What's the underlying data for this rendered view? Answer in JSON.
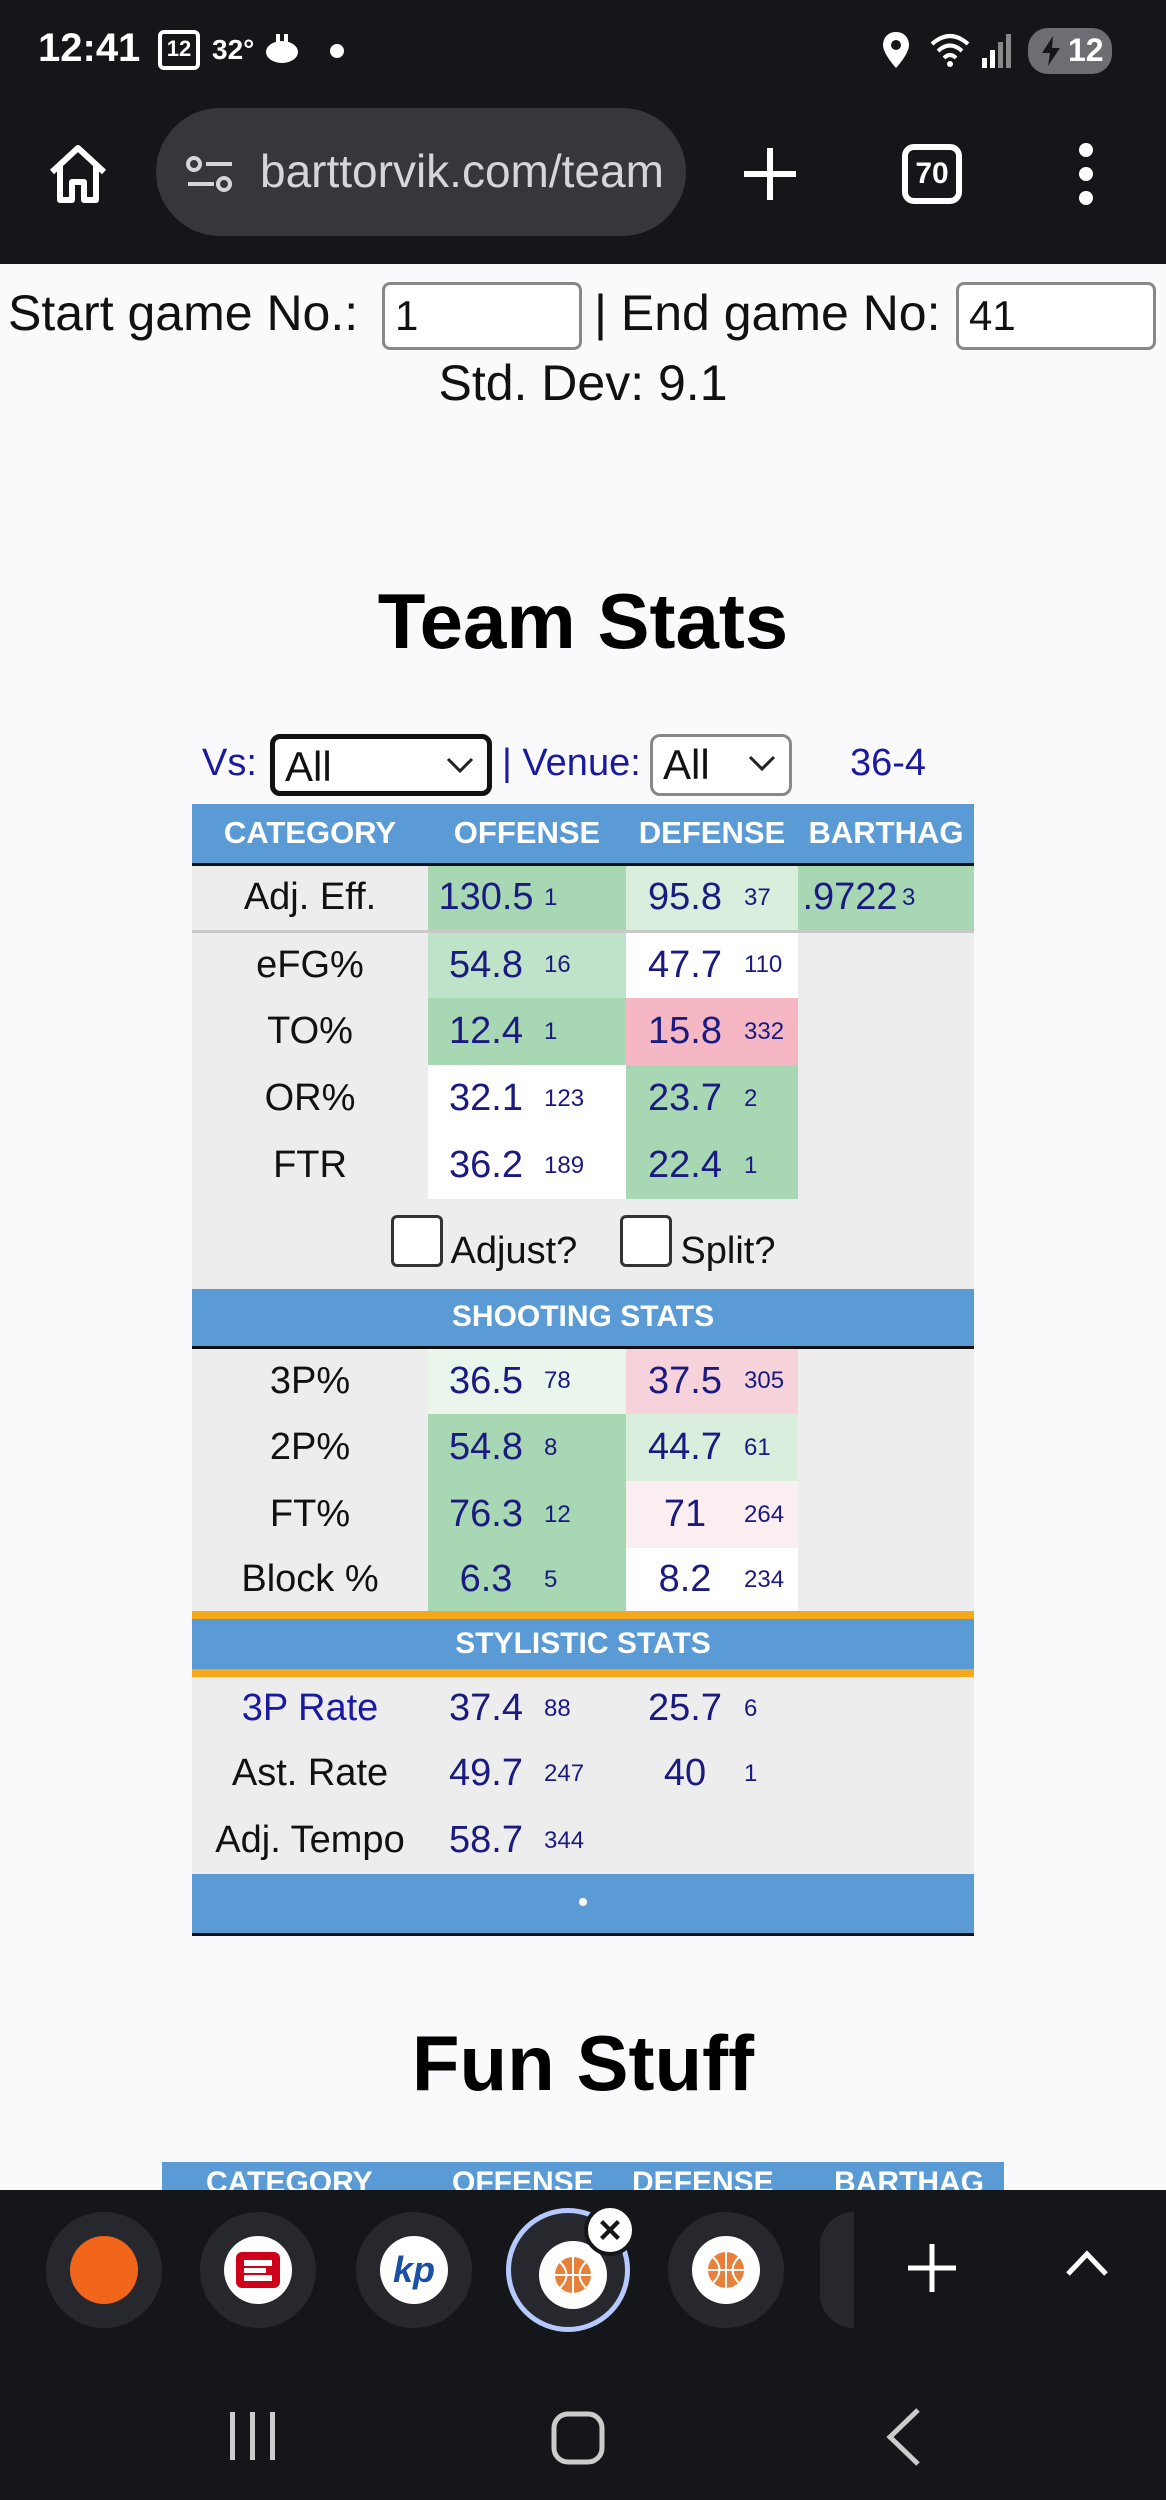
{
  "status_bar": {
    "time": "12:41",
    "calendar_day": "12",
    "temperature": "32°",
    "battery": "12"
  },
  "browser": {
    "url": "barttorvik.com/team",
    "tab_count": "70"
  },
  "game_range": {
    "start_label": "Start game No.:",
    "start_value": "1",
    "end_label": "| End game No:",
    "end_value": "41",
    "std_dev": "Std. Dev: 9.1"
  },
  "team_stats": {
    "title": "Team Stats",
    "vs_label": "Vs:",
    "vs_value": "All",
    "venue_label": "| Venue:",
    "venue_value": "All",
    "record": "36-4",
    "headers": [
      "CATEGORY",
      "OFFENSE",
      "DEFENSE",
      "BARTHAG"
    ],
    "adj_eff": {
      "label": "Adj. Eff.",
      "off": "130.5",
      "off_rank": "1",
      "def": "95.8",
      "def_rank": "37",
      "barthag": ".9722",
      "barthag_rank": "3"
    },
    "four_factors": [
      {
        "label": "eFG%",
        "off": "54.8",
        "off_rank": "16",
        "def": "47.7",
        "def_rank": "110"
      },
      {
        "label": "TO%",
        "off": "12.4",
        "off_rank": "1",
        "def": "15.8",
        "def_rank": "332"
      },
      {
        "label": "OR%",
        "off": "32.1",
        "off_rank": "123",
        "def": "23.7",
        "def_rank": "2"
      },
      {
        "label": "FTR",
        "off": "36.2",
        "off_rank": "189",
        "def": "22.4",
        "def_rank": "1"
      }
    ],
    "adjust_label": "Adjust?",
    "split_label": "Split?",
    "shooting_header": "SHOOTING STATS",
    "shooting": [
      {
        "label": "3P%",
        "off": "36.5",
        "off_rank": "78",
        "def": "37.5",
        "def_rank": "305"
      },
      {
        "label": "2P%",
        "off": "54.8",
        "off_rank": "8",
        "def": "44.7",
        "def_rank": "61"
      },
      {
        "label": "FT%",
        "off": "76.3",
        "off_rank": "12",
        "def": "71",
        "def_rank": "264"
      },
      {
        "label": "Block %",
        "off": "6.3",
        "off_rank": "5",
        "def": "8.2",
        "def_rank": "234"
      }
    ],
    "stylistic_header": "STYLISTIC STATS",
    "stylistic": [
      {
        "label": "3P Rate",
        "off": "37.4",
        "off_rank": "88",
        "def": "25.7",
        "def_rank": "6"
      },
      {
        "label": "Ast. Rate",
        "off": "49.7",
        "off_rank": "247",
        "def": "40",
        "def_rank": "1"
      },
      {
        "label": "Adj. Tempo",
        "off": "58.7",
        "off_rank": "344",
        "def": "",
        "def_rank": ""
      }
    ],
    "footer_dot": "•"
  },
  "fun_stuff": {
    "title": "Fun Stuff",
    "headers": [
      "CATEGORY",
      "OFFENSE",
      "DEFENSE",
      "BARTHAG"
    ]
  },
  "colors": {
    "header_blue": "#5b9bd5",
    "accent_orange": "#f6a81a",
    "link_navy": "#1a1aa0"
  },
  "dock_icons": [
    "orange-app-icon",
    "espn-icon",
    "kenpom-icon",
    "basketball-tab-icon",
    "basketball-tab-icon-2",
    "partial-tab-icon"
  ]
}
